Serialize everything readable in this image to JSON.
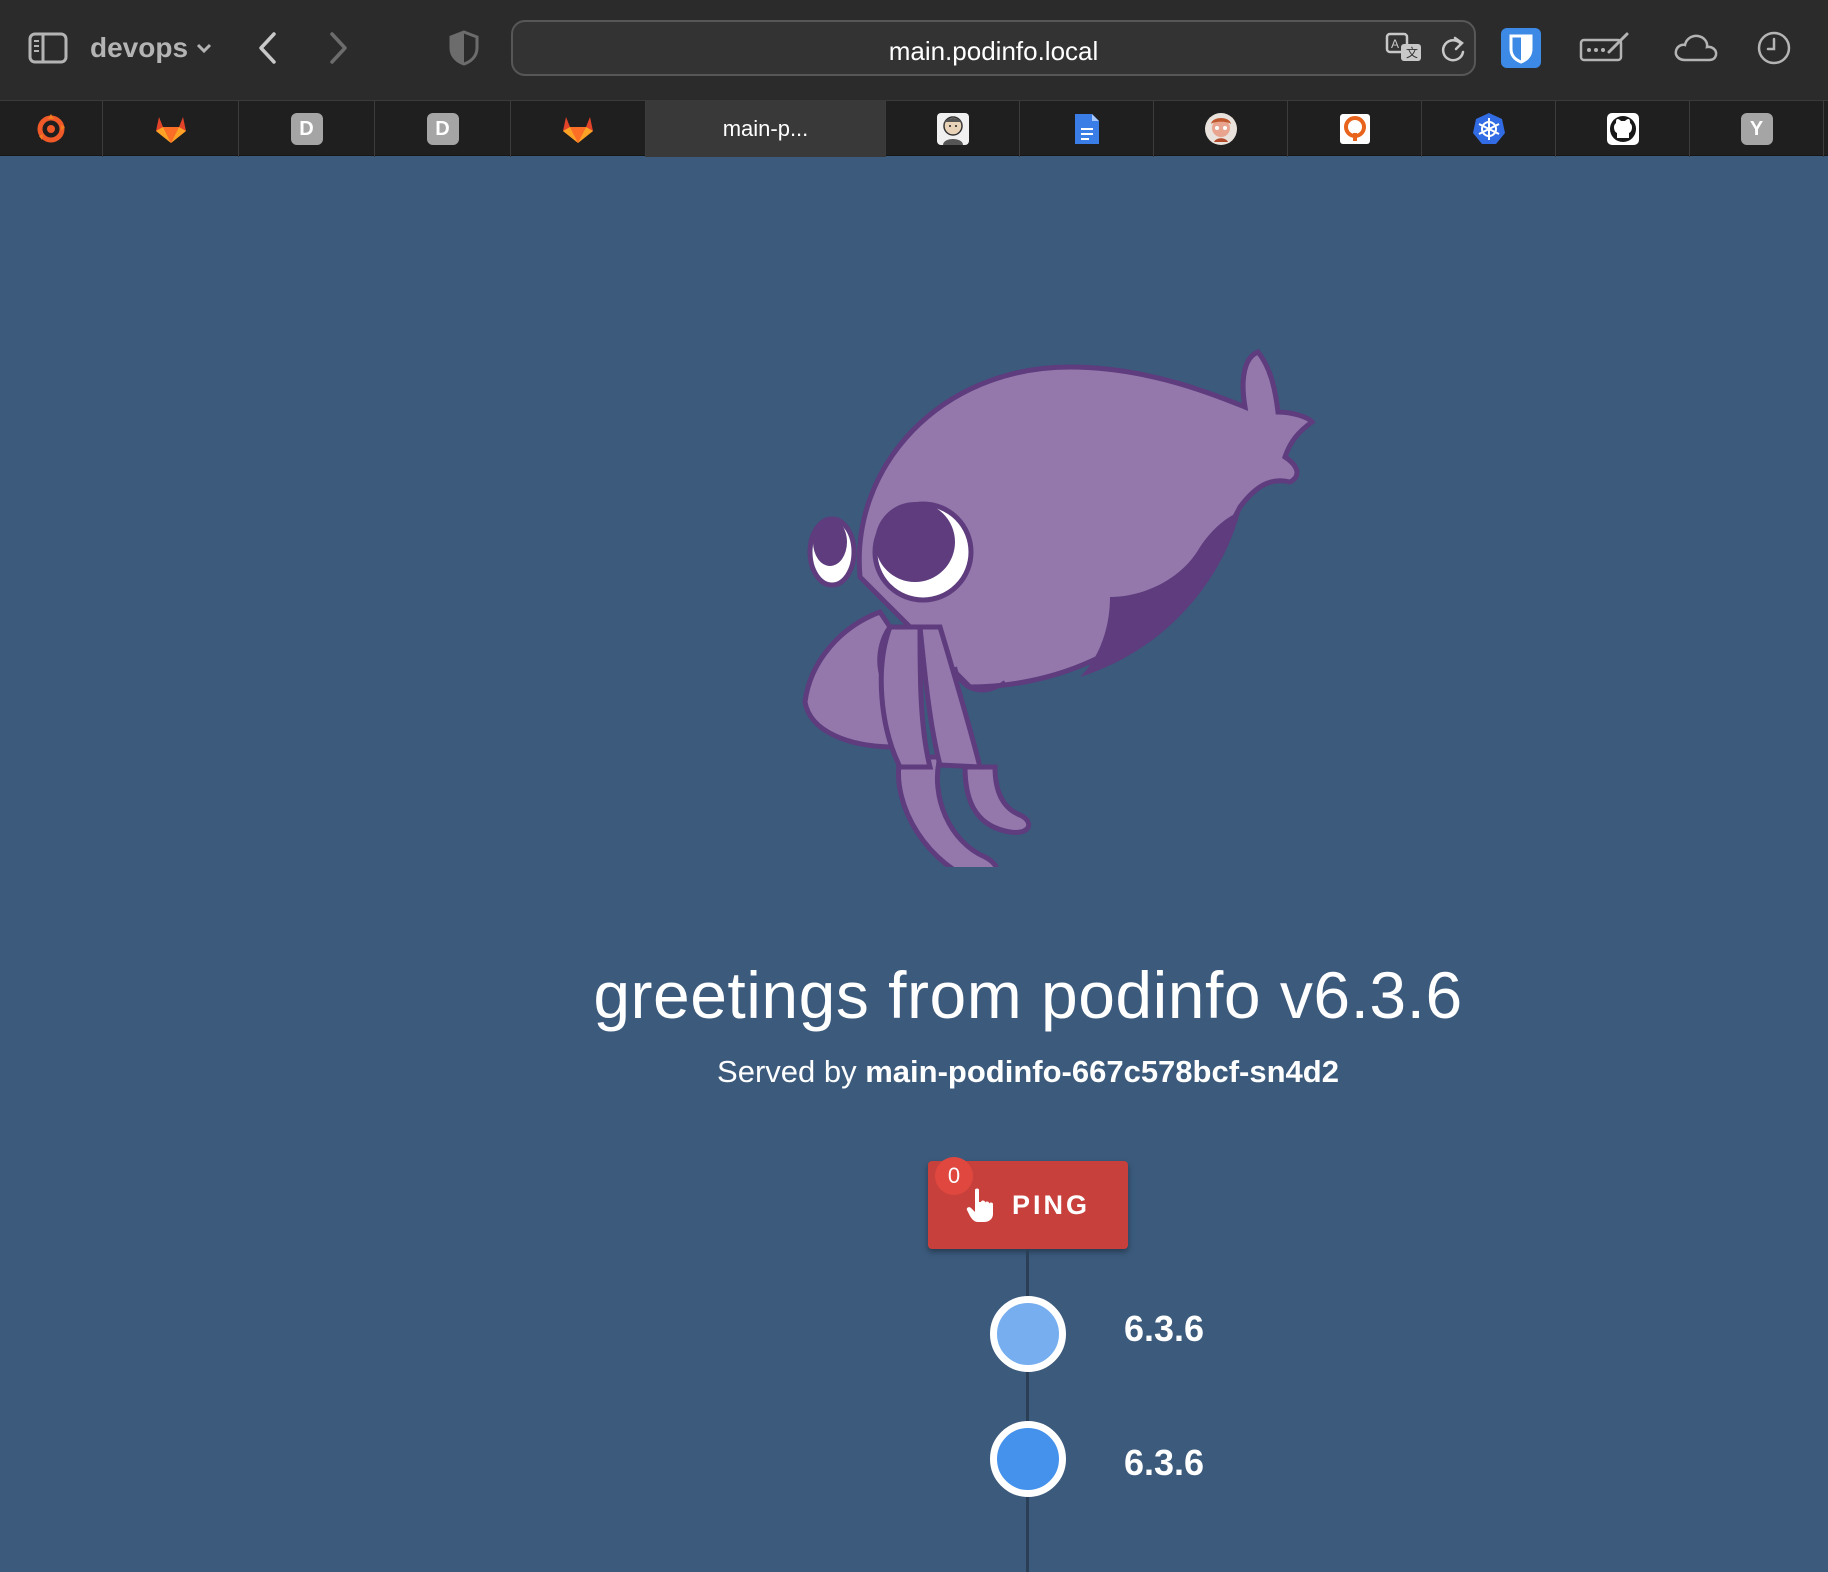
{
  "toolbar": {
    "profile_name": "devops",
    "url": "main.podinfo.local"
  },
  "tabs": [
    {
      "icon": "grafana-icon",
      "title": ""
    },
    {
      "icon": "gitlab-icon",
      "title": ""
    },
    {
      "icon": "letter-d-icon",
      "letter": "D",
      "title": ""
    },
    {
      "icon": "letter-d-icon",
      "letter": "D",
      "title": ""
    },
    {
      "icon": "gitlab-icon",
      "title": ""
    },
    {
      "icon": "",
      "title": "main-p..."
    },
    {
      "icon": "jenkins-icon",
      "title": ""
    },
    {
      "icon": "google-docs-icon",
      "title": ""
    },
    {
      "icon": "avatar-icon",
      "title": ""
    },
    {
      "icon": "orange-tool-icon",
      "title": ""
    },
    {
      "icon": "kubernetes-icon",
      "title": ""
    },
    {
      "icon": "github-icon",
      "title": ""
    },
    {
      "icon": "letter-y-icon",
      "letter": "Y",
      "title": ""
    }
  ],
  "page": {
    "greeting": "greetings from podinfo v6.3.6",
    "served_prefix": "Served by",
    "served_host": "main-podinfo-667c578bcf-sn4d2",
    "ping_label": "PING",
    "ping_count": "0"
  },
  "timeline": [
    {
      "label": "6.3.6",
      "color": "#77aef0"
    },
    {
      "label": "6.3.6",
      "color": "#4592ec"
    }
  ],
  "colors": {
    "page_background": "#3b5a7c",
    "ping_button": "#c8403b",
    "mascot": "#9478ab"
  }
}
